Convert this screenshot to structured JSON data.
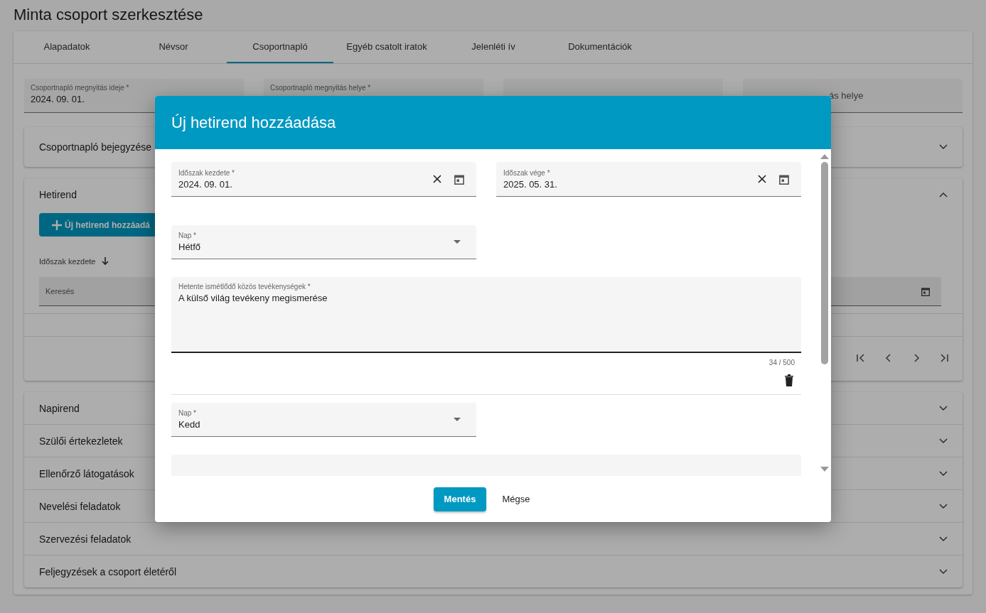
{
  "page_title": "Minta csoport szerkesztése",
  "tabs": [
    {
      "label": "Alapadatok",
      "selected": false
    },
    {
      "label": "Névsor",
      "selected": false
    },
    {
      "label": "Csoportnapló",
      "selected": true
    },
    {
      "label": "Egyéb csatolt iratok",
      "selected": false
    },
    {
      "label": "Jelenléti ív",
      "selected": false
    },
    {
      "label": "Dokumentációk",
      "selected": false
    }
  ],
  "header_fields": [
    {
      "kind": "filled",
      "label": "Csoportnapló megnyitás ideje *",
      "value": "2024. 09. 01."
    },
    {
      "kind": "label_only",
      "label": "Csoportnapló megnyitás helye *"
    },
    {
      "kind": "blank"
    },
    {
      "kind": "placeholder",
      "placeholder": "ás helye"
    }
  ],
  "panels": [
    {
      "title": "Csoportnapló bejegyzése",
      "expanded": false
    },
    {
      "title": "Hetirend",
      "expanded": true
    },
    {
      "title": "Napirend",
      "expanded": false
    },
    {
      "title": "Szülői értekezletek",
      "expanded": false
    },
    {
      "title": "Ellenőrző látogatások",
      "expanded": false
    },
    {
      "title": "Nevelési feladatok",
      "expanded": false
    },
    {
      "title": "Szervezési feladatok",
      "expanded": false
    },
    {
      "title": "Feljegyzések a csoport életéről",
      "expanded": false
    }
  ],
  "hetirend": {
    "add_button": "Új hetirend hozzáadá",
    "sort_column": "Időszak kezdete",
    "search_placeholder": "Keresés"
  },
  "dialog": {
    "title": "Új hetirend hozzáadása",
    "period_fields": [
      {
        "label": "Időszak kezdete *",
        "value": "2024. 09. 01."
      },
      {
        "label": "Időszak vége *",
        "value": "2025. 05. 31."
      }
    ],
    "days": [
      {
        "day_label": "Nap *",
        "day": "Hétfő",
        "activities_label": "Hetente ismétlődő közös tevékenységek *",
        "activities": "A külső világ tevékeny megismerése",
        "counter": "34 / 500"
      },
      {
        "day_label": "Nap *",
        "day": "Kedd"
      }
    ],
    "buttons": [
      {
        "label": "Mentés",
        "kind": "primary"
      },
      {
        "label": "Mégse",
        "kind": "text"
      }
    ]
  }
}
